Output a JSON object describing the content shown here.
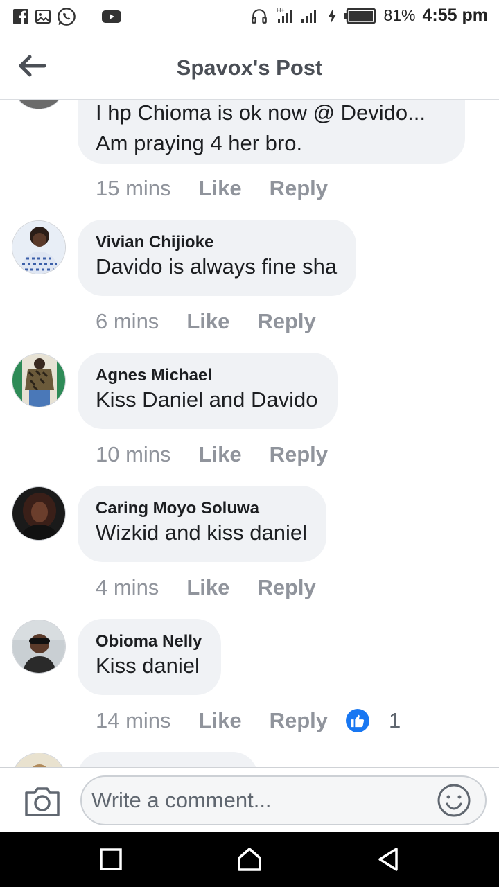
{
  "status_bar": {
    "battery_percent": "81%",
    "time": "4:55 pm",
    "left_icons": [
      "facebook-icon",
      "gallery-icon",
      "whatsapp-icon",
      "youtube-icon"
    ],
    "right_icons": [
      "headphones-icon",
      "signal-icon",
      "charging-icon",
      "battery-icon"
    ]
  },
  "header": {
    "title": "Spavox's Post",
    "back_icon": "back-arrow-icon"
  },
  "comments": [
    {
      "name": "",
      "text_lines": [
        "I hp Chioma is ok now @ Devido...",
        "Am praying 4 her bro."
      ],
      "time": "15 mins",
      "like_label": "Like",
      "reply_label": "Reply"
    },
    {
      "name": "Vivian Chijioke",
      "text_lines": [
        "Davido is always fine sha"
      ],
      "time": "6 mins",
      "like_label": "Like",
      "reply_label": "Reply"
    },
    {
      "name": "Agnes Michael",
      "text_lines": [
        "Kiss Daniel and Davido"
      ],
      "time": "10 mins",
      "like_label": "Like",
      "reply_label": "Reply"
    },
    {
      "name": "Caring Moyo Soluwa",
      "text_lines": [
        "Wizkid and kiss daniel"
      ],
      "time": "4 mins",
      "like_label": "Like",
      "reply_label": "Reply"
    },
    {
      "name": "Obioma Nelly",
      "text_lines": [
        "Kiss daniel"
      ],
      "time": "14 mins",
      "like_label": "Like",
      "reply_label": "Reply",
      "reaction_count": "1"
    }
  ],
  "composer": {
    "placeholder": "Write a comment...",
    "camera_icon": "camera-icon",
    "emoji_icon": "emoji-icon"
  },
  "nav": {
    "icons": [
      "recent-apps-icon",
      "home-icon",
      "back-icon"
    ]
  },
  "colors": {
    "bubble": "#f0f2f5",
    "meta_text": "#90949c",
    "like_blue": "#1877f2"
  }
}
